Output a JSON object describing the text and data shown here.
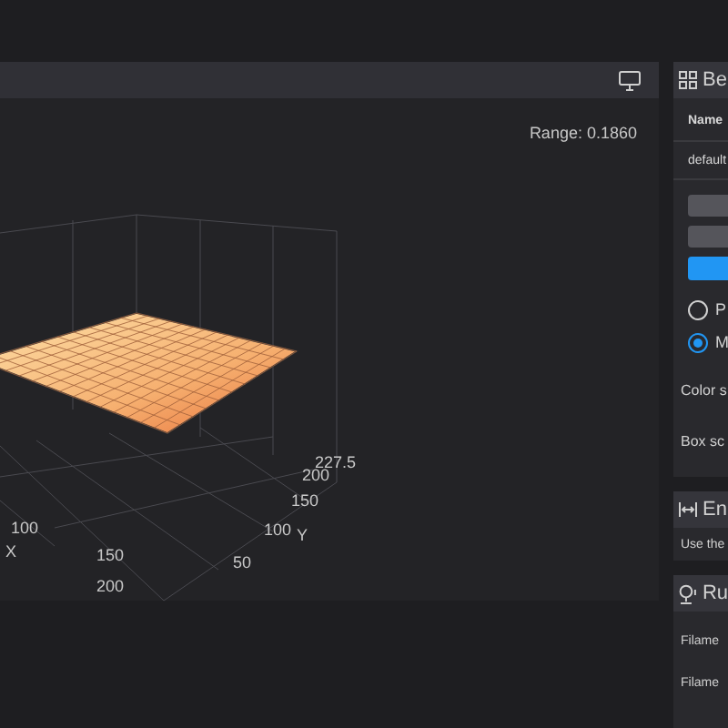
{
  "viewer": {
    "range": "Range: 0.1860",
    "plot": {
      "z_ticks": [
        "227.5"
      ],
      "y_ticks": [
        "200",
        "150",
        "100",
        "50"
      ],
      "y_title": "Y",
      "x_ticks": [
        "100",
        "150",
        "200"
      ],
      "x_title": "X"
    }
  },
  "side_panel": {
    "bed_card": {
      "title": "Be",
      "column_header": "Name",
      "row": "default",
      "buttons": [
        {
          "kind": "secondary"
        },
        {
          "kind": "secondary"
        },
        {
          "kind": "primary"
        }
      ],
      "radios": [
        {
          "label": "P",
          "selected": false
        },
        {
          "label": "M",
          "selected": true
        }
      ],
      "settings": [
        "Color s",
        "Box sc"
      ]
    },
    "endstop_card": {
      "title": "En",
      "text": "Use the"
    },
    "run_card": {
      "title": "Ru",
      "rows": [
        "Filame",
        "Filame"
      ]
    }
  }
}
